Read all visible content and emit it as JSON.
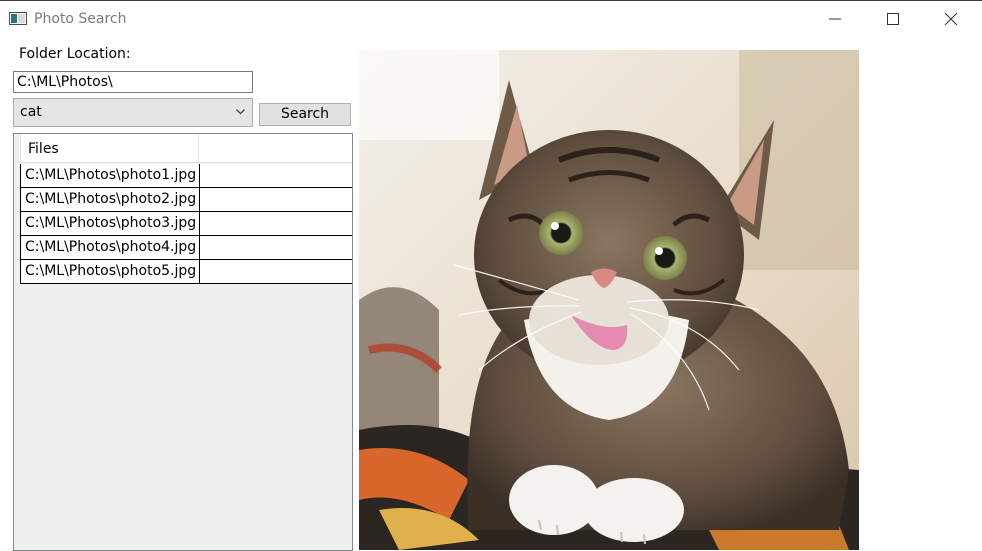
{
  "window": {
    "title": "Photo Search",
    "controls": [
      "minimize",
      "maximize",
      "close"
    ]
  },
  "form": {
    "folder_label": "Folder Location:",
    "folder_value": "C:\\ML\\Photos\\",
    "query_selected": "cat",
    "search_label": "Search"
  },
  "files": {
    "column_header": "Files",
    "items": [
      "C:\\ML\\Photos\\photo1.jpg",
      "C:\\ML\\Photos\\photo2.jpg",
      "C:\\ML\\Photos\\photo3.jpg",
      "C:\\ML\\Photos\\photo4.jpg",
      "C:\\ML\\Photos\\photo5.jpg"
    ]
  },
  "preview": {
    "subject": "tabby-cat-photo",
    "colors": {
      "background": "#e8e4dc",
      "fur": "#6b5a48",
      "eyes": "#9aa36a",
      "tongue": "#e58ab0",
      "fabric_accent": "#d9662a"
    }
  }
}
